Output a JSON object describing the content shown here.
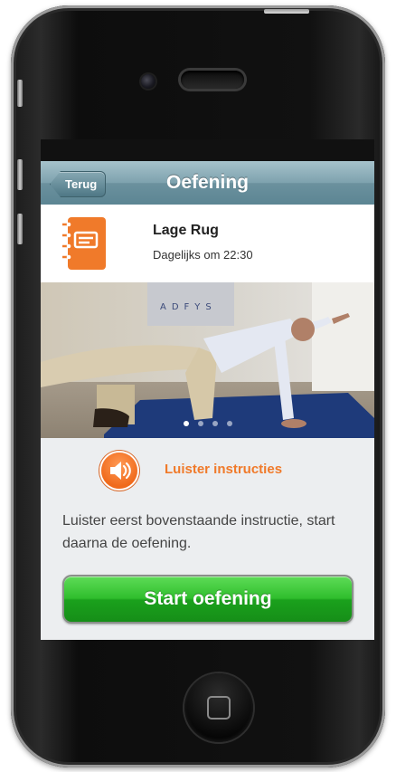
{
  "nav": {
    "back_label": "Terug",
    "title": "Oefening"
  },
  "exercise": {
    "title": "Lage Rug",
    "schedule": "Dagelijks om 22:30",
    "icon": "notebook-icon"
  },
  "photo": {
    "wall_text": "ADFYS",
    "slide_index": 1,
    "slide_count": 4
  },
  "audio": {
    "label": "Luister instructies",
    "icon": "speaker-icon"
  },
  "instructions": "Luister eerst bovenstaande instructie, start daarna de oefening.",
  "start_button": "Start oefening",
  "colors": {
    "accent_orange": "#F07A2A",
    "nav_blue": "#6E94A1",
    "start_green": "#2DB82B",
    "screen_bg": "#ECEEF0"
  }
}
